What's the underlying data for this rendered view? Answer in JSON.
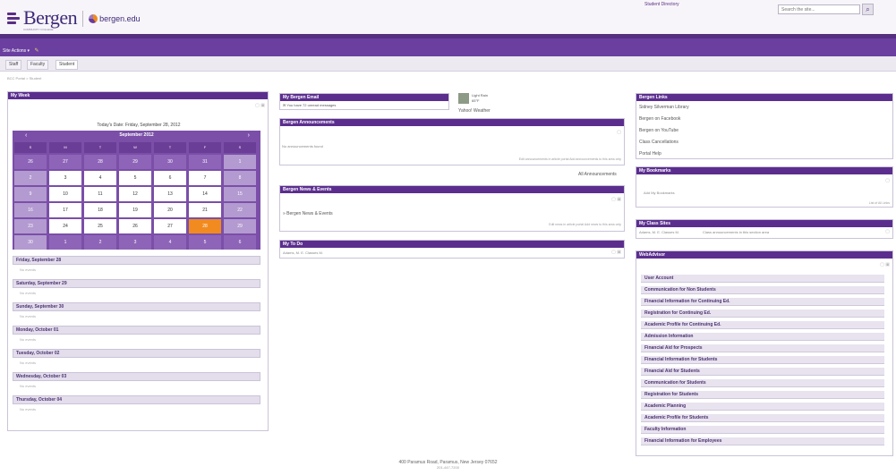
{
  "header": {
    "logo_text": "Bergen",
    "logo_tagline": "COMMUNITY COLLEGE",
    "site_link": "bergen.edu",
    "top_link": "Student Directory",
    "search_placeholder": "Search the site...",
    "search_icon": "search-icon"
  },
  "actions": {
    "site_actions": "Site Actions",
    "caret": "▾",
    "edit_icon": "edit-icon"
  },
  "tabs": [
    "Staff",
    "Faculty",
    "Student"
  ],
  "active_tab": 2,
  "breadcrumb": "BCC Portal > Student",
  "colors": {
    "primary": "#5b2e8e",
    "accent": "#f18b1f"
  },
  "my_week": {
    "title": "My Week",
    "todays_date": "Today's Date:  Friday, September 28, 2012",
    "calendar_month": "September 2012",
    "prev": "‹",
    "next": "›",
    "day_names": [
      "S",
      "M",
      "T",
      "W",
      "T",
      "F",
      "S"
    ],
    "weeks": [
      [
        "26",
        "27",
        "28",
        "29",
        "30",
        "31",
        "1"
      ],
      [
        "2",
        "3",
        "4",
        "5",
        "6",
        "7",
        "8"
      ],
      [
        "9",
        "10",
        "11",
        "12",
        "13",
        "14",
        "15"
      ],
      [
        "16",
        "17",
        "18",
        "19",
        "20",
        "21",
        "22"
      ],
      [
        "23",
        "24",
        "25",
        "26",
        "27",
        "28",
        "29"
      ],
      [
        "30",
        "1",
        "2",
        "3",
        "4",
        "5",
        "6"
      ]
    ],
    "today": "28",
    "days": [
      {
        "label": "Friday, September 28",
        "note": "No events"
      },
      {
        "label": "Saturday, September 29",
        "note": "No events"
      },
      {
        "label": "Sunday, September 30",
        "note": "No events"
      },
      {
        "label": "Monday, October 01",
        "note": "No events"
      },
      {
        "label": "Tuesday, October 02",
        "note": "No events"
      },
      {
        "label": "Wednesday, October 03",
        "note": "No events"
      },
      {
        "label": "Thursday, October 04",
        "note": "No events"
      }
    ]
  },
  "email": {
    "title": "My Bergen Email",
    "message": "You have 72 unread messages"
  },
  "weather": {
    "condition": "Light Rain",
    "temp": "65°F",
    "source": "Yahoo! Weather"
  },
  "announcements": {
    "title": "Bergen Announcements",
    "empty": "No announcements found",
    "footer_links": "Edit announcements in article portal     Add announcements to this area only",
    "all_link": "All Announcements"
  },
  "news": {
    "title": "Bergen News & Events",
    "item": "Bergen News & Events",
    "footer_links": "Edit news in article portal     Add news to this area only"
  },
  "todo": {
    "title": "My To Do",
    "item": "Adams, M. E.   Classes M."
  },
  "bergen_links": {
    "title": "Bergen Links",
    "items": [
      "Sidney Silverman Library",
      "Bergen on Facebook",
      "Bergen on YouTube",
      "Class Cancellations",
      "Portal Help"
    ]
  },
  "bookmarks": {
    "title": "My Bookmarks",
    "empty": "Add My Bookmarks",
    "more": "List of All Links"
  },
  "class_sites": {
    "title": "My Class Sites",
    "item": "Adams, M. E.   Classes M.",
    "note": "Class announcements in this section area"
  },
  "webadvisor": {
    "title": "WebAdvisor",
    "items": [
      "User Account",
      "Communication for Non Students",
      "Financial Information for Continuing Ed.",
      "Registration for Continuing Ed.",
      "Academic Profile for Continuing Ed.",
      "Admission Information",
      "Financial Aid for Prospects",
      "Financial Information for Students",
      "Financial Aid for Students",
      "Communication for Students",
      "Registration for Students",
      "Academic Planning",
      "Academic Profile for Students",
      "Faculty Information",
      "Financial Information for Employees"
    ]
  },
  "footer": {
    "address": "400 Paramus Road, Paramus, New Jersey 07652",
    "phone": "201-447-7200"
  }
}
